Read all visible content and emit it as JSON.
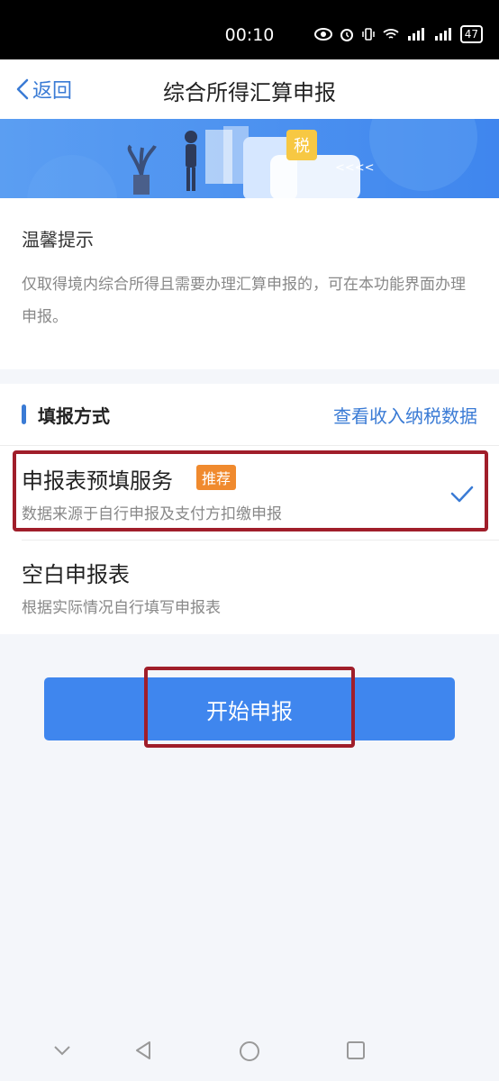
{
  "status_bar": {
    "time": "00:10",
    "battery": "47"
  },
  "nav": {
    "back_label": "返回",
    "title": "综合所得汇算申报"
  },
  "banner": {
    "tax_label": "税",
    "arrows": "<<<<"
  },
  "tips": {
    "title": "温馨提示",
    "body": "仅取得境内综合所得且需要办理汇算申报的，可在本功能界面办理申报。"
  },
  "method": {
    "title": "填报方式",
    "link": "查看收入纳税数据",
    "options": [
      {
        "title": "申报表预填服务",
        "badge": "推荐",
        "subtitle": "数据来源于自行申报及支付方扣缴申报",
        "selected": true
      },
      {
        "title": "空白申报表",
        "subtitle": "根据实际情况自行填写申报表",
        "selected": false
      }
    ]
  },
  "start_button": {
    "label": "开始申报"
  },
  "colors": {
    "accent": "#3a7bd5",
    "badge": "#f08a2e",
    "highlight": "#a01e2a"
  },
  "icons": [
    "back-chevron-icon",
    "check-icon",
    "nav-down-icon",
    "nav-back-icon",
    "nav-home-icon",
    "nav-recent-icon"
  ]
}
